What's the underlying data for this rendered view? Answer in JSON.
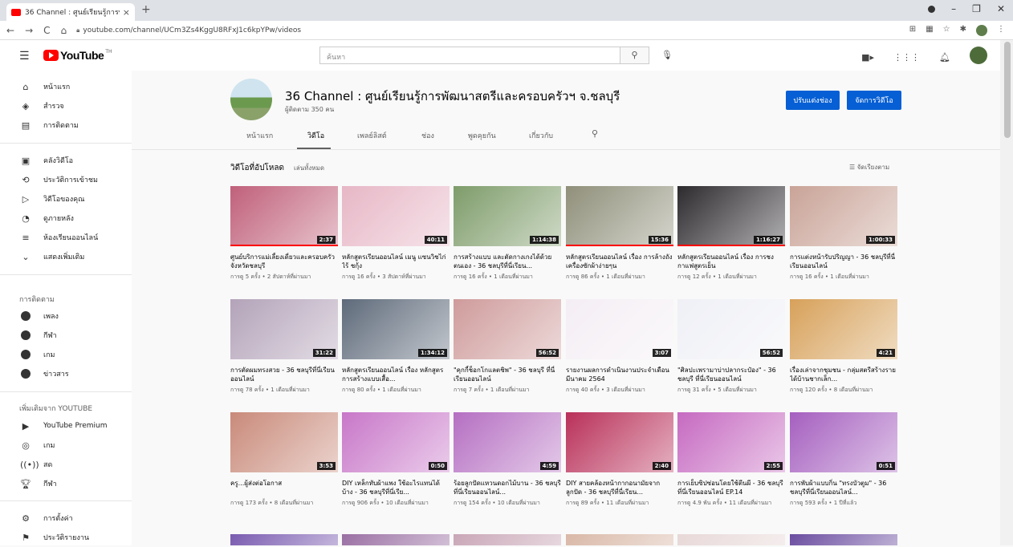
{
  "browser": {
    "tab_title": "36 Channel : ศูนย์เรียนรู้การพัฒนาส",
    "tab_close": "×",
    "new_tab": "+",
    "url": "youtube.com/channel/UCm3Zs4KggU8RFxJ1c6kpYPw/videos"
  },
  "header": {
    "logo_text": "YouTube",
    "logo_sup": "TH",
    "search_placeholder": "ค้นหา"
  },
  "sidebar": {
    "main": [
      {
        "label": "หน้าแรก",
        "icon": "home-icon"
      },
      {
        "label": "สำรวจ",
        "icon": "explore-icon"
      },
      {
        "label": "การติดตาม",
        "icon": "subscriptions-icon"
      }
    ],
    "library": [
      {
        "label": "คลังวิดีโอ",
        "icon": "library-icon"
      },
      {
        "label": "ประวัติการเข้าชม",
        "icon": "history-icon"
      },
      {
        "label": "วิดีโอของคุณ",
        "icon": "your-videos-icon"
      },
      {
        "label": "ดูภายหลัง",
        "icon": "watch-later-icon"
      },
      {
        "label": "ห้องเรียนออนไลน์",
        "icon": "playlist-icon"
      },
      {
        "label": "แสดงเพิ่มเติม",
        "icon": "chevron-down-icon"
      }
    ],
    "subs_heading": "การติดตาม",
    "subs": [
      {
        "label": "เพลง"
      },
      {
        "label": "กีฬา"
      },
      {
        "label": "เกม"
      },
      {
        "label": "ข่าวสาร"
      }
    ],
    "more_heading": "เพิ่มเติมจาก YOUTUBE",
    "more": [
      {
        "label": "YouTube Premium",
        "icon": "youtube-icon"
      },
      {
        "label": "เกม",
        "icon": "gaming-icon"
      },
      {
        "label": "สด",
        "icon": "live-icon"
      },
      {
        "label": "กีฬา",
        "icon": "trophy-icon"
      }
    ],
    "bottom": [
      {
        "label": "การตั้งค่า",
        "icon": "gear-icon"
      },
      {
        "label": "ประวัติรายงาน",
        "icon": "flag-icon"
      }
    ]
  },
  "channel": {
    "name": "36 Channel : ศูนย์เรียนรู้การพัฒนาสตรีและครอบครัวฯ จ.ชลบุรี",
    "subscribers": "ผู้ติดตาม 350 คน",
    "customize_button": "ปรับแต่งช่อง",
    "manage_button": "จัดการวิดีโอ",
    "tabs": [
      "หน้าแรก",
      "วิดีโอ",
      "เพลย์ลิสต์",
      "ช่อง",
      "พูดคุยกัน",
      "เกี่ยวกับ"
    ],
    "active_tab": 1
  },
  "section": {
    "title": "วิดีโอที่อัปโหลด",
    "play_all": "เล่นทั้งหมด",
    "sort": "จัดเรียงตาม"
  },
  "videos": [
    {
      "title": "ศูนย์บริการแม่เลี้ยงเดี่ยวและครอบครัว จังหวัดชลบุรี",
      "meta": "การดู 5 ครั้ง • 2 สัปดาห์ที่ผ่านมา",
      "duration": "2:37",
      "color": "#c0607a",
      "progress": 1.0
    },
    {
      "title": "หลักสูตรเรียนออนไลน์ เมนู แซนวิชไก่ไร้ ชกุ้ง",
      "meta": "การดู 16 ครั้ง • 3 สัปดาห์ที่ผ่านมา",
      "duration": "40:11",
      "color": "#e7b7c6",
      "progress": 0
    },
    {
      "title": "การสร้างแบบ และตัดกางเกงได้ด้วยตนเอง - 36 ชลบุรีที่นี่เรียน...",
      "meta": "การดู 16 ครั้ง • 1 เดือนที่ผ่านมา",
      "duration": "1:14:38",
      "color": "#7e9c6a",
      "progress": 0
    },
    {
      "title": "หลักสูตรเรียนออนไลน์ เรื่อง การล้างถังเครื่องซักผ้าง่ายๆน",
      "meta": "การดู 86 ครั้ง • 1 เดือนที่ผ่านมา",
      "duration": "15:36",
      "color": "#8f8f7a",
      "progress": 1.0
    },
    {
      "title": "หลักสูตรเรียนออนไลน์ เรื่อง การชงกาแฟสูตรเย็น",
      "meta": "การดู 12 ครั้ง • 1 เดือนที่ผ่านมา",
      "duration": "1:16:27",
      "color": "#2d2a2e",
      "progress": 1.0
    },
    {
      "title": "การแต่งหน้ารับปริญญา - 36 ชลบุรีที่นี่เรียนออนไลน์",
      "meta": "การดู 16 ครั้ง • 1 เดือนที่ผ่านมา",
      "duration": "1:00:33",
      "color": "#c9a397",
      "progress": 0
    },
    {
      "title": "การตัดผมทรงสวย - 36 ชลบุรีที่นี่เรียนออนไลน์",
      "meta": "การดู 78 ครั้ง • 1 เดือนที่ผ่านมา",
      "duration": "31:22",
      "color": "#b3a3b9",
      "progress": 0
    },
    {
      "title": "หลักสูตรเรียนออนไลน์ เรื่อง หลักสูตรการสร้างแบบเสื้อ...",
      "meta": "การดู 80 ครั้ง • 1 เดือนที่ผ่านมา",
      "duration": "1:34:12",
      "color": "#5e6a7a",
      "progress": 0
    },
    {
      "title": "\"คุกกี้ช็อกโกแลตชิพ\" - 36 ชลบุรี ที่นี่เรียนออนไลน์",
      "meta": "การดู 7 ครั้ง • 1 เดือนที่ผ่านมา",
      "duration": "56:52",
      "color": "#cf9b9b",
      "progress": 0
    },
    {
      "title": "รายงานผลการดำเนินงานประจำเดือนมีนาคม 2564",
      "meta": "การดู 40 ครั้ง • 3 เดือนที่ผ่านมา",
      "duration": "3:07",
      "color": "#f4eef4",
      "progress": 0
    },
    {
      "title": "\"ศิลปะเพรามาบ่าปลากระป๋อง\" - 36 ชลบุรี ที่นี่เรียนออนไลน์",
      "meta": "การดู 31 ครั้ง • 5 เดือนที่ผ่านมา",
      "duration": "56:52",
      "color": "#eff0f6",
      "progress": 0
    },
    {
      "title": "เรื่องเล่าจากชุมชน - กลุ่มสตรีสร้างรายได้บ้านชากเล็ก...",
      "meta": "การดู 120 ครั้ง • 8 เดือนที่ผ่านมา",
      "duration": "4:21",
      "color": "#d7a15a",
      "progress": 0
    },
    {
      "title": "ครู...ผู้ส่งต่อโอกาส",
      "meta": "การดู 173 ครั้ง • 8 เดือนที่ผ่านมา",
      "duration": "3:53",
      "color": "#c98a7a",
      "progress": 0
    },
    {
      "title": "DIY เหล็กทับผ้าแพง ใช้อะไรแทนได้บ้าง - 36 ชลบุรีที่นี่เรีย...",
      "meta": "การดู 906 ครั้ง • 10 เดือนที่ผ่านมา",
      "duration": "0:50",
      "color": "#c877c8",
      "progress": 0
    },
    {
      "title": "ร้อยลูกปัดแหวนดอกไม้บาน - 36 ชลบุรีที่นี่เรียนออนไลน์...",
      "meta": "การดู 154 ครั้ง • 10 เดือนที่ผ่านมา",
      "duration": "4:59",
      "color": "#b56fc2",
      "progress": 0
    },
    {
      "title": "DIY สายคล้องหน้ากากอนามัยจากลูกปัด - 36 ชลบุรีที่นี่เรียน...",
      "meta": "การดู 89 ครั้ง • 11 เดือนที่ผ่านมา",
      "duration": "2:40",
      "color": "#b9305a",
      "progress": 0
    },
    {
      "title": "การเย็บซิปซ่อนโดยใช้ตีนผี - 36 ชลบุรีที่นี่เรียนออนไลน์ EP.14",
      "meta": "การดู 4.9 พัน ครั้ง • 11 เดือนที่ผ่านมา",
      "duration": "2:55",
      "color": "#c66ac1",
      "progress": 0
    },
    {
      "title": "การพับผ้าแบบกิ่น \"ทรงบัวตูม\" - 36 ชลบุรีที่นี่เรียนออนไลน์...",
      "meta": "การดู 593 ครั้ง • 1 ปีที่แล้ว",
      "duration": "0:51",
      "color": "#a55fbf",
      "progress": 0
    }
  ],
  "partial_row_colors": [
    "#7a5bb0",
    "#9a6fa3",
    "#c9a6b6",
    "#d9b8a7",
    "#e8d8d8",
    "#6b4da0"
  ]
}
